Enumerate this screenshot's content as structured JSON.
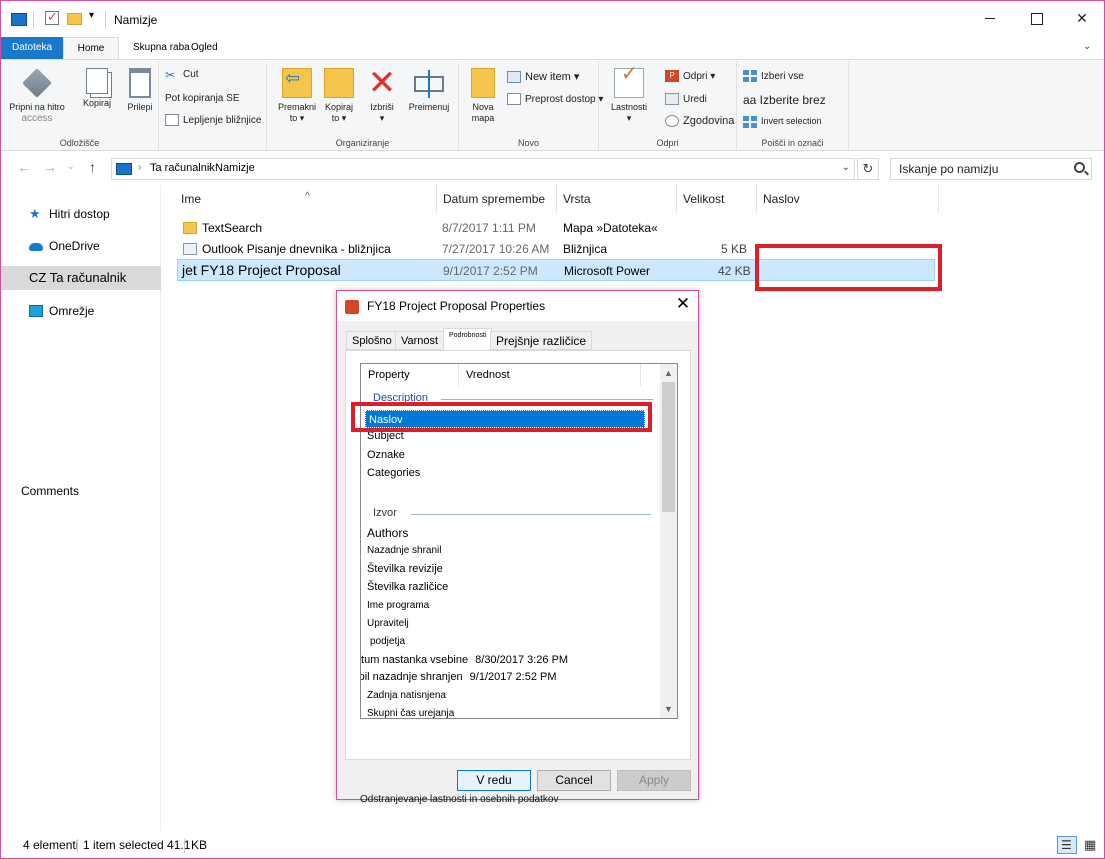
{
  "window": {
    "title": "Namizje",
    "colors": {
      "file_tab": "#1979ca",
      "selection": "#cce8ff",
      "highlight": "#e01e2a",
      "border": "#d34ea0"
    }
  },
  "ribbon": {
    "tabs": {
      "file": "Datoteka",
      "home": "Home",
      "share": "Skupna raba",
      "view": "Ogled"
    },
    "clipboard": {
      "pin_line1": "Pripni na hitro",
      "pin_line2": "access",
      "copy": "Kopiraj",
      "paste": "Prilepi",
      "cut": "Cut",
      "copy_path": "Pot kopiranja SE",
      "paste_shortcut": "Lepljenje bližnjice",
      "label": "Odložišče"
    },
    "organize": {
      "move_line1": "Premakni",
      "move_line2": "to ▾",
      "copy_line1": "Kopiraj",
      "copy_line2": "to ▾",
      "delete_line1": "Izbriši",
      "delete_line2": "▾",
      "rename": "Preimenuj",
      "label": "Organiziranje"
    },
    "new": {
      "folder_line1": "Nova",
      "folder_line2": "mapa",
      "new_item": "New item ▾",
      "easy_access": "Preprost dostop ▾",
      "label": "Novo"
    },
    "open": {
      "properties_line1": "Lastnosti",
      "properties_line2": "▾",
      "open": "Odpri ▾",
      "edit": "Uredi",
      "history": "Zgodovina",
      "label": "Odpri"
    },
    "select": {
      "select_all": "Izberi vse",
      "select_none": "aa Izberite brez",
      "invert": "Invert selection",
      "label": "Poišči in označi"
    }
  },
  "address": {
    "pc": "Ta računalnik",
    "folder": "Namizje",
    "search_placeholder": "Iskanje po namizju"
  },
  "navpane": {
    "quick_access": "Hitri dostop",
    "onedrive": "OneDrive",
    "this_pc": "CZ Ta računalnik",
    "network": "Omrežje",
    "comments": "Comments"
  },
  "filelist": {
    "columns": {
      "name": "Ime",
      "date": "Datum spremembe",
      "type": "Vrsta",
      "size": "Velikost",
      "title": "Naslov"
    },
    "rows": [
      {
        "name": "TextSearch",
        "date": "8/7/2017 1:11 PM",
        "type": "Mapa »Datoteka«",
        "size": "",
        "icon": "folder-icon"
      },
      {
        "name": "Outlook Pisanje dnevnika - bližnjica",
        "date": "7/27/2017 10:26 AM",
        "type": "Bližnjica",
        "size": "5 KB",
        "icon": "shortcut-icon"
      },
      {
        "name": "jet FY18 Project Proposal",
        "date": "9/1/2017 2:52 PM",
        "type": "Microsoft Power",
        "size": "42 KB",
        "icon": "powerpoint-icon"
      }
    ]
  },
  "status": {
    "count": "4 elementi",
    "selected": "1 item selected 41.1",
    "unit": "KB"
  },
  "dialog": {
    "title": "FY18 Project Proposal Properties",
    "tabs": {
      "general": "Splošno",
      "security": "Varnost",
      "details": "Podrobnosti",
      "previous": "Prejšnje različice"
    },
    "headers": {
      "property": "Property",
      "value": "Vrednost"
    },
    "groups": {
      "description": "Description",
      "origin": "Izvor"
    },
    "rows": {
      "title": "Naslov",
      "subject": "Subject",
      "tags": "Oznake",
      "categories": "Categories",
      "authors": "Authors",
      "last_saved_by": "Nazadnje shranil",
      "revision": "Številka revizije",
      "version": "Številka različice",
      "program": "Ime programa",
      "manager": "Upravitelj",
      "company": "podjetja",
      "created_label": "Datum nastanka vsebine",
      "created_value": "8/30/2017 3:26 PM",
      "saved_label": "je bil nazadnje shranjen",
      "saved_value": "9/1/2017 2:52 PM",
      "last_printed": "Zadnja natisnjena",
      "edit_time": "Skupni čas urejanja"
    },
    "remove_link": "Odstranjevanje lastnosti in osebnih podatkov",
    "buttons": {
      "ok": "V redu",
      "cancel": "Cancel",
      "apply": "Apply"
    }
  }
}
